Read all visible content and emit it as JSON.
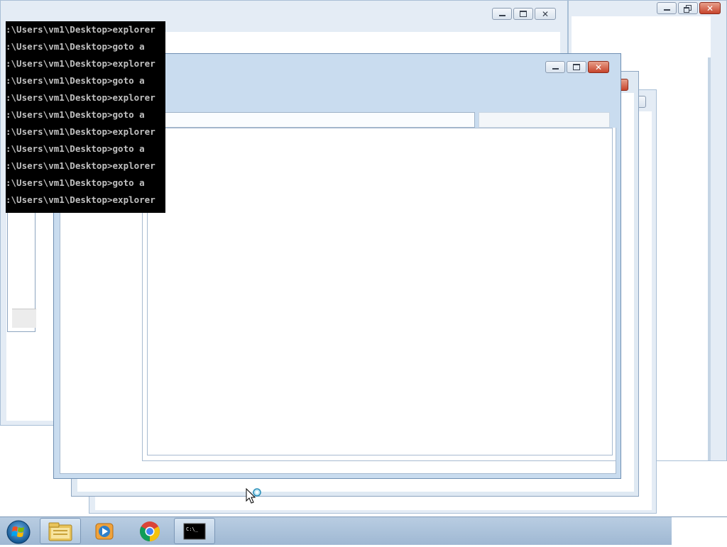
{
  "console": {
    "lines": [
      ":\\Users\\vm1\\Desktop>explorer",
      ":\\Users\\vm1\\Desktop>goto a",
      ":\\Users\\vm1\\Desktop>explorer",
      ":\\Users\\vm1\\Desktop>goto a",
      ":\\Users\\vm1\\Desktop>explorer",
      ":\\Users\\vm1\\Desktop>goto a",
      ":\\Users\\vm1\\Desktop>explorer",
      ":\\Users\\vm1\\Desktop>goto a",
      ":\\Users\\vm1\\Desktop>explorer",
      ":\\Users\\vm1\\Desktop>goto a",
      ":\\Users\\vm1\\Desktop>explorer"
    ]
  },
  "taskbar": {
    "items": [
      {
        "icon": "windows-explorer-folder-icon",
        "active": true
      },
      {
        "icon": "windows-media-player-icon",
        "active": false
      },
      {
        "icon": "chrome-icon",
        "active": false
      },
      {
        "icon": "command-prompt-icon",
        "active": true
      }
    ],
    "cmd_icon_text": "C:\\_"
  },
  "icons": {
    "start": "windows-start-orb",
    "cursor": "busy-arrow-cursor"
  },
  "colors": {
    "frame": "#dfe9f3",
    "close_active": "#c7452c",
    "console_bg": "#000000",
    "console_text": "#c0c0c0"
  }
}
